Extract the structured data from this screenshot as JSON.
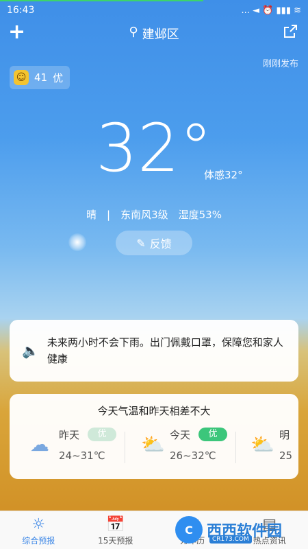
{
  "status": {
    "time": "16:43",
    "icons_text": "... ◄ ⏰ ▮▮▮ ≋",
    "load_fraction": 0.66
  },
  "header": {
    "location": "建邺区",
    "publish": "刚刚发布"
  },
  "aqi": {
    "value": "41",
    "level": "优"
  },
  "current": {
    "temperature": "32°",
    "feels_like": "体感32°",
    "conditions": "晴　|　东南风3级　湿度53%"
  },
  "feedback": {
    "label": "反馈"
  },
  "alert": {
    "text": "未来两小时不会下雨。出门佩戴口罩，保障您和家人健康"
  },
  "compare": {
    "title": "今天气温和昨天相差不大",
    "days": [
      {
        "name": "昨天",
        "badge": "优",
        "range": "24~31℃",
        "icon": "rain-cloud-icon",
        "badge_color": "#cfe9d9",
        "badge_text_color": "#ffffff"
      },
      {
        "name": "今天",
        "badge": "优",
        "range": "26~32℃",
        "icon": "partly-cloudy-icon",
        "badge_color": "#3cc67b",
        "badge_text_color": "#ffffff"
      },
      {
        "name": "明",
        "badge": "",
        "range": "25",
        "icon": "partly-cloudy-icon"
      }
    ]
  },
  "nav": [
    {
      "label": "综合预报",
      "active": true
    },
    {
      "label": "15天预报",
      "active": false
    },
    {
      "label": "万年历",
      "active": false
    },
    {
      "label": "热点资讯",
      "active": false
    }
  ],
  "watermark": {
    "text": "西西软件园",
    "sub": "CR173.COM"
  },
  "colors": {
    "accent": "#3b86e6",
    "good": "#3cc67b"
  }
}
